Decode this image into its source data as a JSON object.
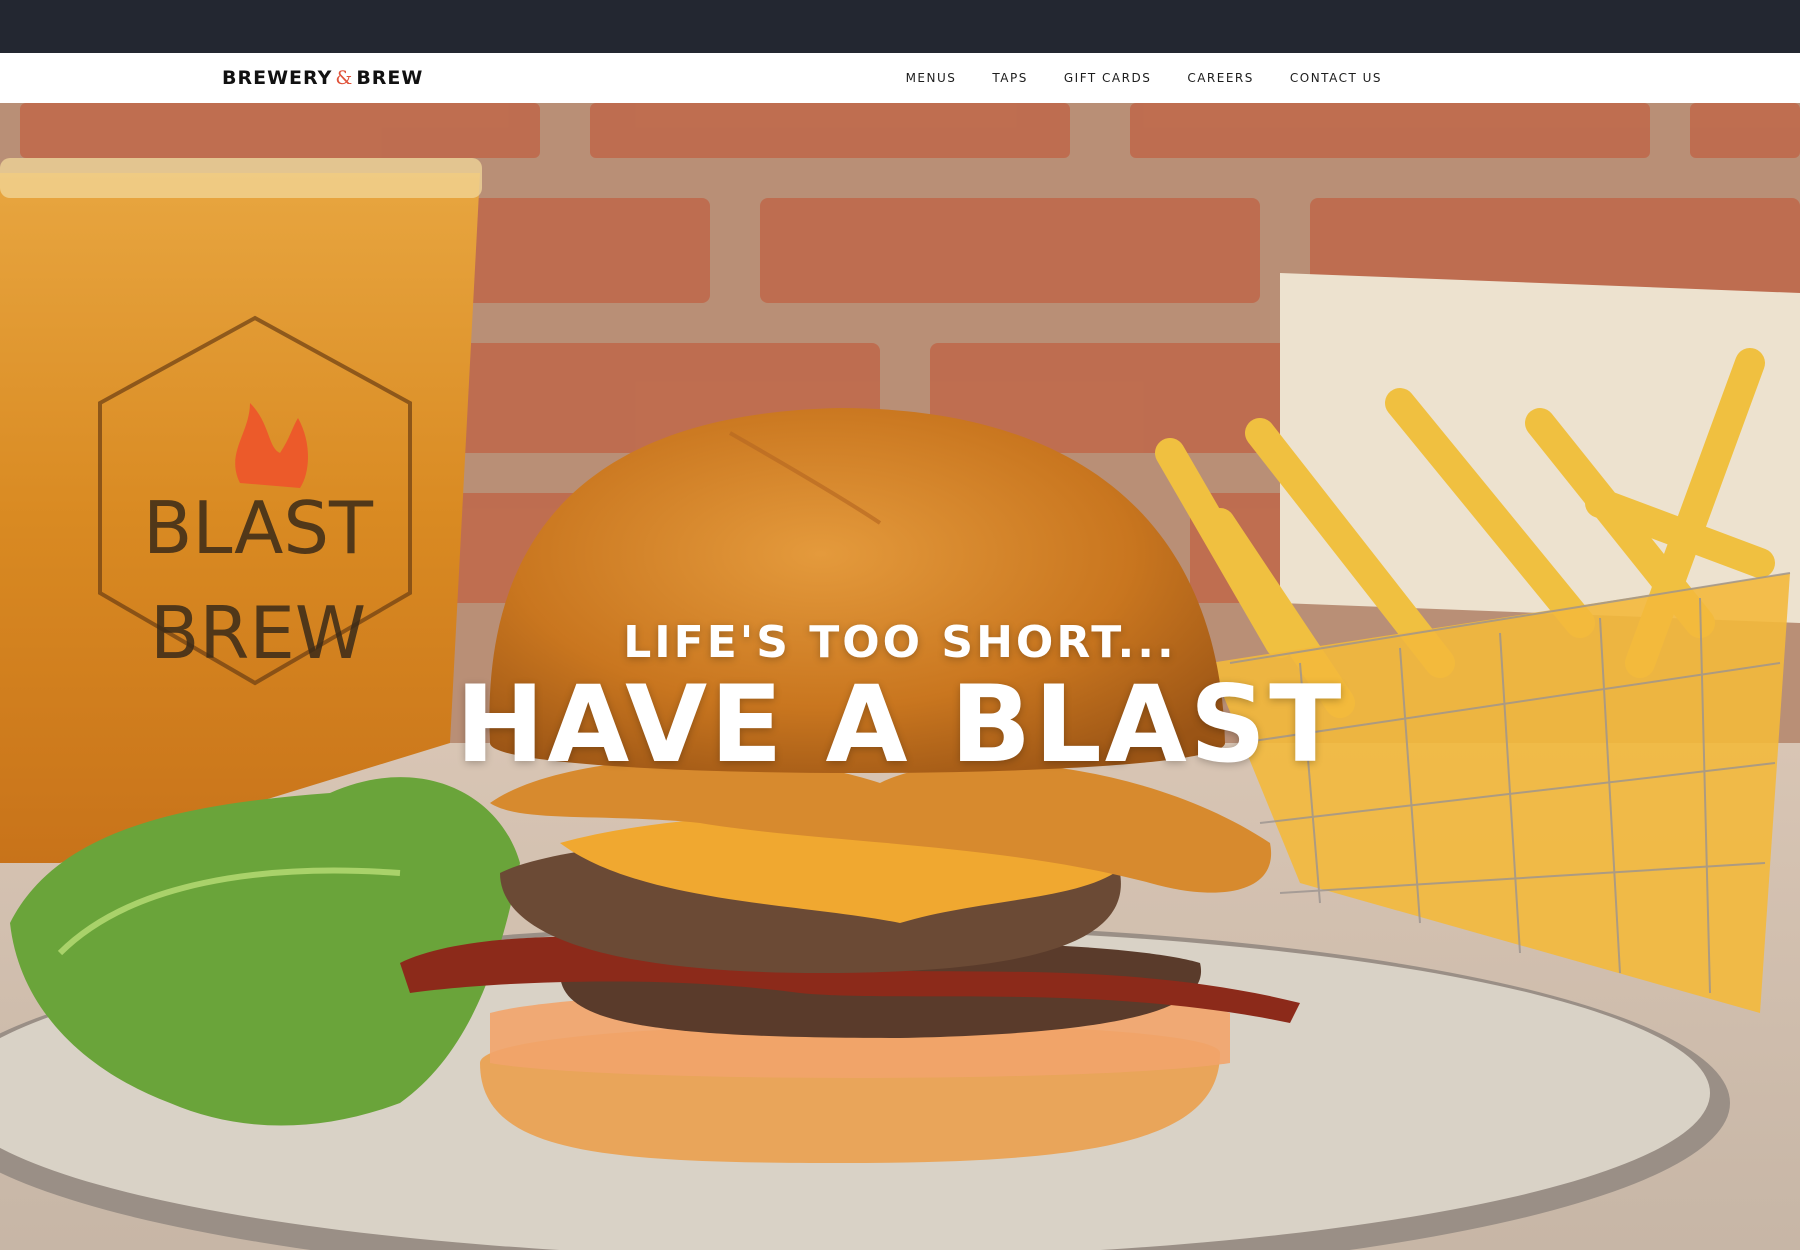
{
  "header": {
    "logo": {
      "left": "BREWERY",
      "amp": "&",
      "right": "BREW"
    },
    "nav": [
      {
        "label": "MENUS"
      },
      {
        "label": "TAPS"
      },
      {
        "label": "GIFT CARDS"
      },
      {
        "label": "CAREERS"
      },
      {
        "label": "CONTACT US"
      }
    ]
  },
  "hero": {
    "tagline": "LIFE'S TOO SHORT...",
    "title": "HAVE A BLAST",
    "glass_logo": {
      "line1": "BLAST",
      "line2": "BREW"
    },
    "image_description_icon": "burger-beer-fries-photo"
  },
  "colors": {
    "topbar": "#232731",
    "navbar": "#ffffff",
    "accent": "#e0533a",
    "headline": "#ffffff"
  }
}
